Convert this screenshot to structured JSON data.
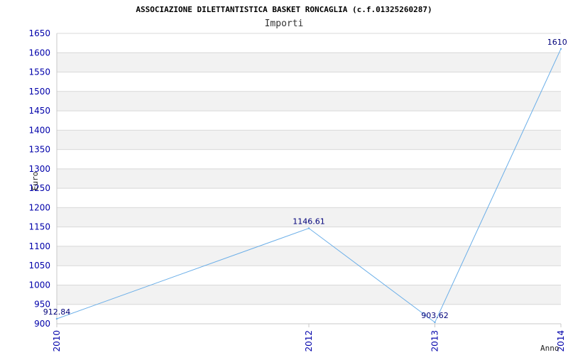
{
  "chart_data": {
    "type": "line",
    "title": "ASSOCIAZIONE DILETTANTISTICA BASKET RONCAGLIA (c.f.01325260287)",
    "subtitle": "Importi",
    "xlabel": "Anno",
    "ylabel": "Euro",
    "categories": [
      "2010",
      "2012",
      "2013",
      "2014"
    ],
    "series": [
      {
        "values": [
          912.84,
          1146.61,
          903.62,
          1610.0
        ],
        "data_labels": [
          "912.84",
          "1146.61",
          "903.62",
          "1610.0"
        ]
      }
    ],
    "ylim": [
      900,
      1650
    ],
    "yticks": [
      900,
      950,
      1000,
      1050,
      1100,
      1150,
      1200,
      1250,
      1300,
      1350,
      1400,
      1450,
      1500,
      1550,
      1600,
      1650
    ],
    "ytick_labels": [
      "900",
      "950",
      "1000",
      "1050",
      "1100",
      "1150",
      "1200",
      "1250",
      "1300",
      "1350",
      "1400",
      "1450",
      "1500",
      "1550",
      "1600",
      "1650"
    ],
    "grid": true,
    "legend": "none",
    "colors": {
      "line": "#6aaee8",
      "band": "#f2f2f2",
      "grid": "#d8d8d8",
      "tick_text": "#0000aa",
      "data_label_text": "#00007a"
    }
  }
}
